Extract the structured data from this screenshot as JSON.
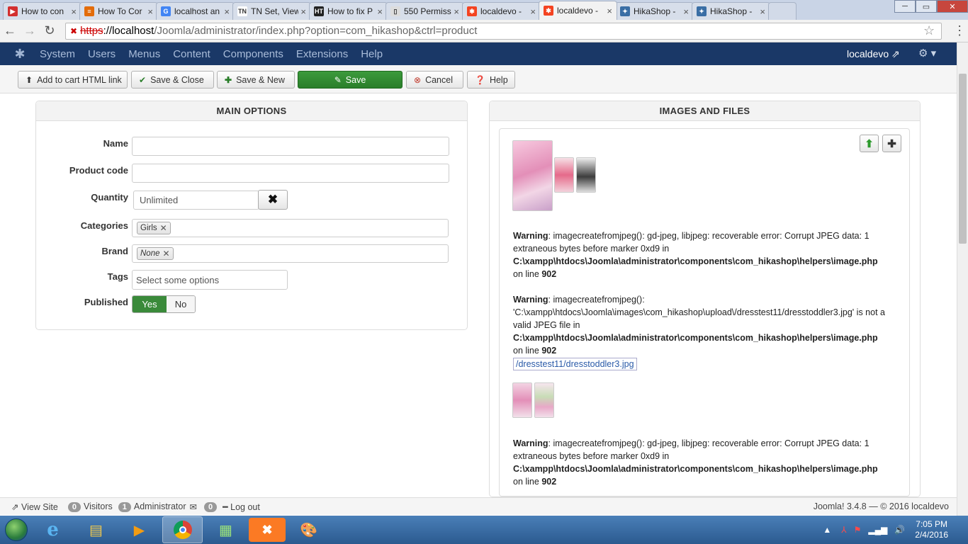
{
  "browser": {
    "tabs": [
      {
        "title": "How to con",
        "favicon_color": "#d32f2f",
        "favicon": "▶"
      },
      {
        "title": "How To Cor",
        "favicon_color": "#e36c0a",
        "favicon": "≡"
      },
      {
        "title": "localhost an",
        "favicon_color": "#4285f4",
        "favicon": "G"
      },
      {
        "title": "TN Set, View, Ch",
        "favicon_color": "#ffffff",
        "favicon": "TN"
      },
      {
        "title": "How to fix P",
        "favicon_color": "#222222",
        "favicon": "HT"
      },
      {
        "title": "550 Permiss",
        "favicon_color": "#dddddd",
        "favicon": "▯"
      },
      {
        "title": "localdevo - ",
        "favicon_color": "#f44321",
        "favicon": "✱"
      },
      {
        "title": "localdevo - ",
        "favicon_color": "#f44321",
        "favicon": "✱"
      },
      {
        "title": "HikaShop - ",
        "favicon_color": "#3a6ea5",
        "favicon": "✦"
      },
      {
        "title": "HikaShop - ",
        "favicon_color": "#3a6ea5",
        "favicon": "✦"
      }
    ],
    "url": {
      "scheme": "https",
      "host": "://localhost",
      "path": "/Joomla/administrator/index.php?option=com_hikashop&ctrl=product"
    }
  },
  "joomla_nav": {
    "items": [
      "System",
      "Users",
      "Menus",
      "Content",
      "Components",
      "Extensions",
      "Help"
    ],
    "site_name": "localdevo"
  },
  "toolbar": {
    "add_to_cart": "Add to cart HTML link",
    "save_close": "Save & Close",
    "save_new": "Save & New",
    "save": "Save",
    "cancel": "Cancel",
    "help": "Help"
  },
  "main_options": {
    "header": "MAIN OPTIONS",
    "name_label": "Name",
    "name_value": "",
    "code_label": "Product code",
    "code_value": "",
    "quantity_label": "Quantity",
    "quantity_value": "Unlimited",
    "categories_label": "Categories",
    "categories": [
      "Girls"
    ],
    "brand_label": "Brand",
    "brand_value": "None",
    "tags_label": "Tags",
    "tags_placeholder": "Select some options",
    "published_label": "Published",
    "published_yes": "Yes",
    "published_no": "No",
    "published": true
  },
  "images_files": {
    "header": "IMAGES AND FILES",
    "warnings": [
      {
        "label": "Warning",
        "text": ": imagecreatefromjpeg(): gd-jpeg, libjpeg: recoverable error: Corrupt JPEG data: 1 extraneous bytes before marker 0xd9 in",
        "file": "C:\\xampp\\htdocs\\Joomla\\administrator\\components\\com_hikashop\\helpers\\image.php",
        "line_text": "on line ",
        "line": "902"
      },
      {
        "label": "Warning",
        "text": ": imagecreatefromjpeg(): 'C:\\xampp\\htdocs\\Joomla\\images\\com_hikashop\\upload\\/dresstest11/dresstoddler3.jpg' is not a valid JPEG file in",
        "file": "C:\\xampp\\htdocs\\Joomla\\administrator\\components\\com_hikashop\\helpers\\image.php",
        "line_text": "on line ",
        "line": "902"
      },
      {
        "label": "Warning",
        "text": ": imagecreatefromjpeg(): gd-jpeg, libjpeg: recoverable error: Corrupt JPEG data: 1 extraneous bytes before marker 0xd9 in",
        "file": "C:\\xampp\\htdocs\\Joomla\\administrator\\components\\com_hikashop\\helpers\\image.php",
        "line_text": "on line ",
        "line": "902"
      }
    ],
    "file_link": "/dresstest11/dresstoddler3.jpg"
  },
  "statusbar": {
    "view_site": "View Site",
    "visitors_count": "0",
    "visitors_label": "Visitors",
    "admin_count": "1",
    "admin_label": "Administrator",
    "messages_count": "0",
    "logout": "Log out",
    "version": "Joomla! 3.4.8 — © 2016 localdevo"
  },
  "taskbar": {
    "time": "7:05 PM",
    "date": "2/4/2016"
  }
}
